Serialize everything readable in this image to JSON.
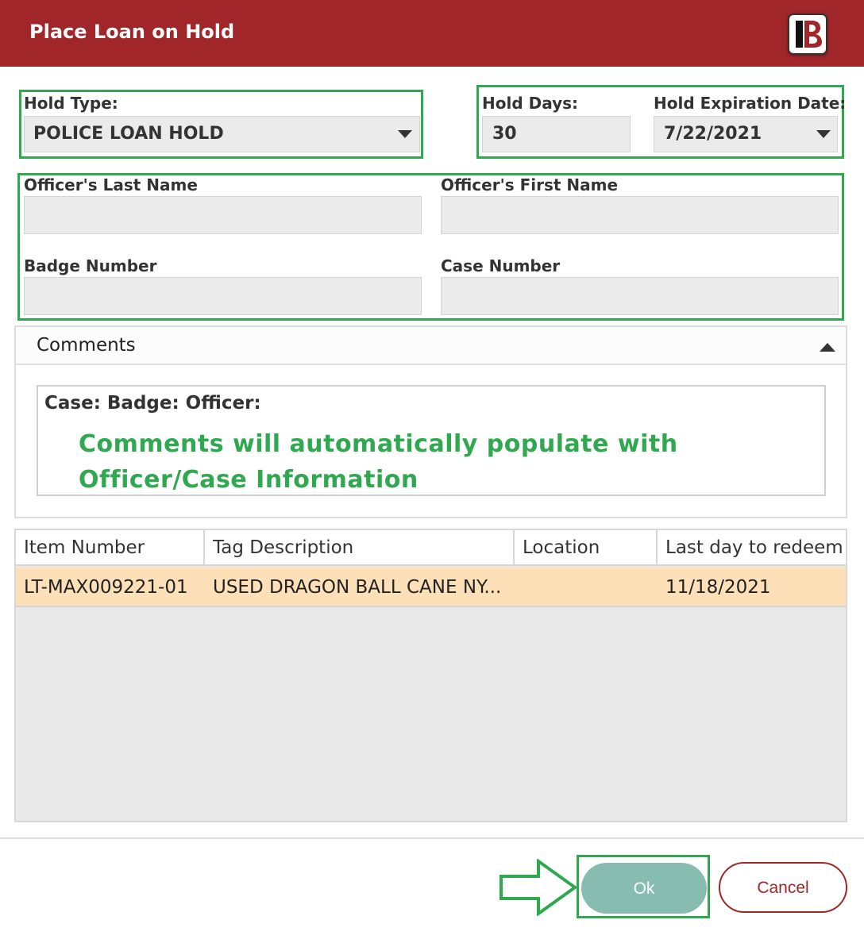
{
  "window": {
    "title": "Place Loan on Hold"
  },
  "hold_type": {
    "label": "Hold Type:",
    "value": "POLICE LOAN HOLD"
  },
  "hold_days": {
    "label": "Hold Days:",
    "value": "30"
  },
  "hold_expiration": {
    "label": "Hold Expiration Date:",
    "value": "7/22/2021"
  },
  "officer": {
    "last_name_label": "Officer's Last Name",
    "last_name_value": "",
    "first_name_label": "Officer's First Name",
    "first_name_value": "",
    "badge_label": "Badge Number",
    "badge_value": "",
    "case_label": "Case Number",
    "case_value": ""
  },
  "comments": {
    "title": "Comments",
    "text": "Case:  Badge:  Officer:",
    "note_line1": "Comments will automatically populate with",
    "note_line2": "Officer/Case Information"
  },
  "grid": {
    "columns": [
      "Item Number",
      "Tag Description",
      "Location",
      "Last day to redeem"
    ],
    "rows": [
      {
        "item_number": "LT-MAX009221-01",
        "tag_description": "USED DRAGON BALL CANE NY...",
        "location": "",
        "last_day": "11/18/2021"
      }
    ]
  },
  "footer": {
    "ok_label": "Ok",
    "cancel_label": "Cancel"
  },
  "colors": {
    "title_bar": "#a0262a",
    "highlight": "#2fa84f",
    "ok_button": "#87bcb1",
    "selected_row": "#fde0b8"
  }
}
